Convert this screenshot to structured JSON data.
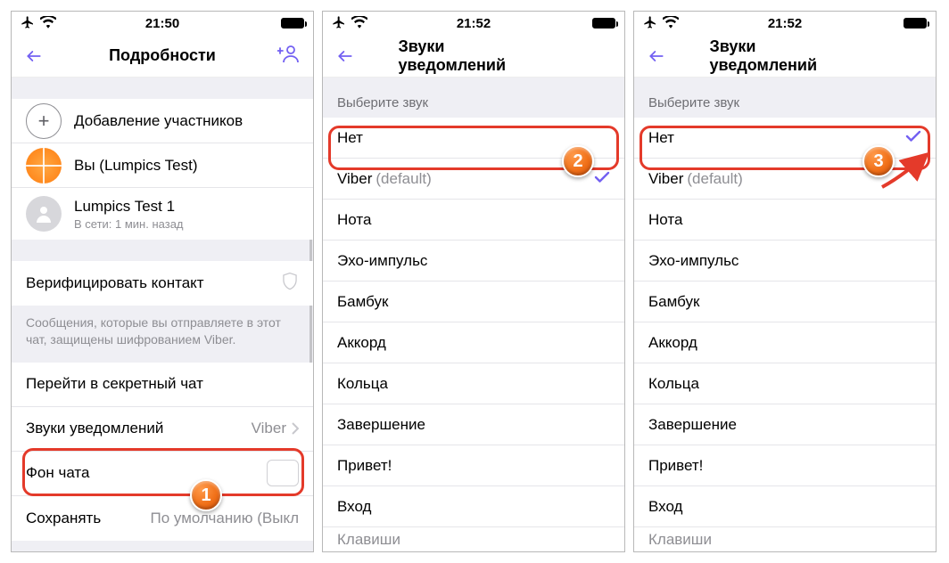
{
  "status": {
    "time1": "21:50",
    "time2": "21:52",
    "time3": "21:52"
  },
  "screen1": {
    "title": "Подробности",
    "add_participants": "Добавление участников",
    "you_label": "Вы (Lumpics Test)",
    "member_name": "Lumpics Test 1",
    "member_status": "В сети: 1 мин. назад",
    "verify_contact": "Верифицировать контакт",
    "encryption_text": "Сообщения, которые вы отправляете в этот чат, защищены шифрованием Viber.",
    "secret_chat": "Перейти в секретный чат",
    "notification_sounds": "Звуки уведомлений",
    "notification_value": "Viber",
    "chat_bg": "Фон чата",
    "save": "Сохранять",
    "save_value_truncated": "По умолчанию (Выкл"
  },
  "screen2": {
    "title": "Звуки уведомлений",
    "header": "Выберите звук",
    "selected_index": 1
  },
  "screen3": {
    "title": "Звуки уведомлений",
    "header": "Выберите звук",
    "selected_index": 0
  },
  "sounds": {
    "items": [
      {
        "label": "Нет"
      },
      {
        "label": "Viber",
        "default_suffix": "(default)"
      },
      {
        "label": "Нота"
      },
      {
        "label": "Эхо-импульс"
      },
      {
        "label": "Бамбук"
      },
      {
        "label": "Аккорд"
      },
      {
        "label": "Кольца"
      },
      {
        "label": "Завершение"
      },
      {
        "label": "Привет!"
      },
      {
        "label": "Вход"
      },
      {
        "label": "Клавиши"
      }
    ]
  },
  "badges": {
    "b1": "1",
    "b2": "2",
    "b3": "3"
  }
}
